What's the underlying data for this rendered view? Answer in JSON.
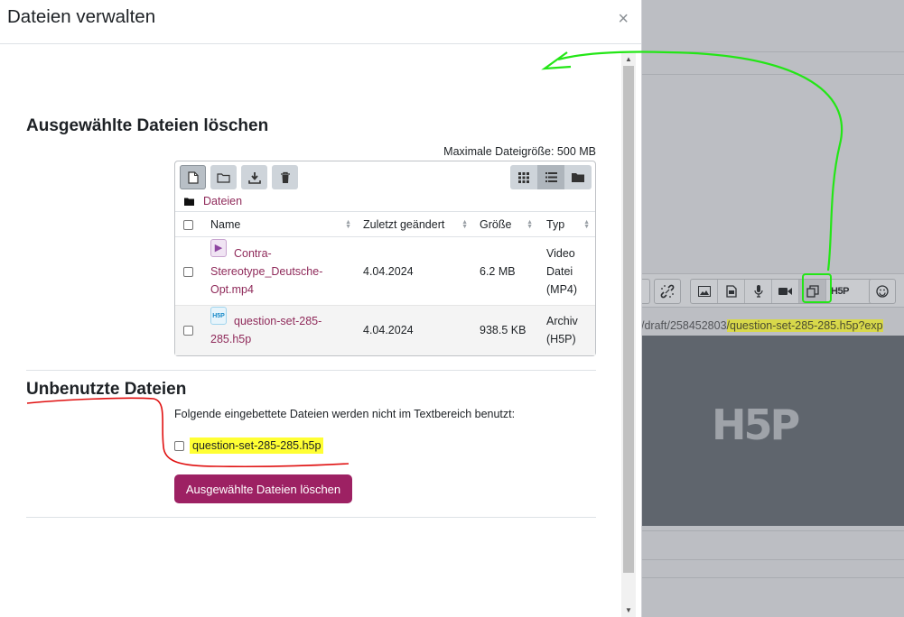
{
  "modal": {
    "title": "Dateien verwalten",
    "close": "×"
  },
  "delete_section": {
    "title": "Ausgewählte Dateien löschen",
    "max_size": "Maximale Dateigröße: 500 MB"
  },
  "filepicker": {
    "path": "Dateien",
    "columns": {
      "name": "Name",
      "modified": "Zuletzt geändert",
      "size": "Größe",
      "type": "Typ"
    },
    "files": [
      {
        "name": "Contra-Stereotype_Deutsche-Opt.mp4",
        "name_lines": [
          "Contra-",
          "Stereotype_Deutsche-",
          "Opt.mp4"
        ],
        "modified": "4.04.2024",
        "size": "6.2 MB",
        "type_lines": [
          "Video",
          "Datei",
          "(MP4)"
        ]
      },
      {
        "name": "question-set-285-285.h5p",
        "name_lines": [
          "question-set-285-",
          "285.h5p"
        ],
        "modified": "4.04.2024",
        "size": "938.5 KB",
        "type_lines": [
          "Archiv",
          "(H5P)"
        ]
      }
    ]
  },
  "unused_section": {
    "title": "Unbenutzte Dateien",
    "description": "Folgende eingebettete Dateien werden nicht im Textbereich benutzt:",
    "file": "question-set-285-285.h5p",
    "button": "Ausgewählte Dateien löschen"
  },
  "background": {
    "url_prefix": "/draft/258452803",
    "url_highlight": "/question-set-285-285.h5p?exp",
    "h5p_logo": "H5P",
    "toolbar_h5p": "H5P"
  },
  "colors": {
    "brand": "#9d2163",
    "link": "#8f2a5a",
    "highlight": "#ffff33",
    "annotation_green": "#23e616",
    "annotation_red": "#e01010"
  }
}
